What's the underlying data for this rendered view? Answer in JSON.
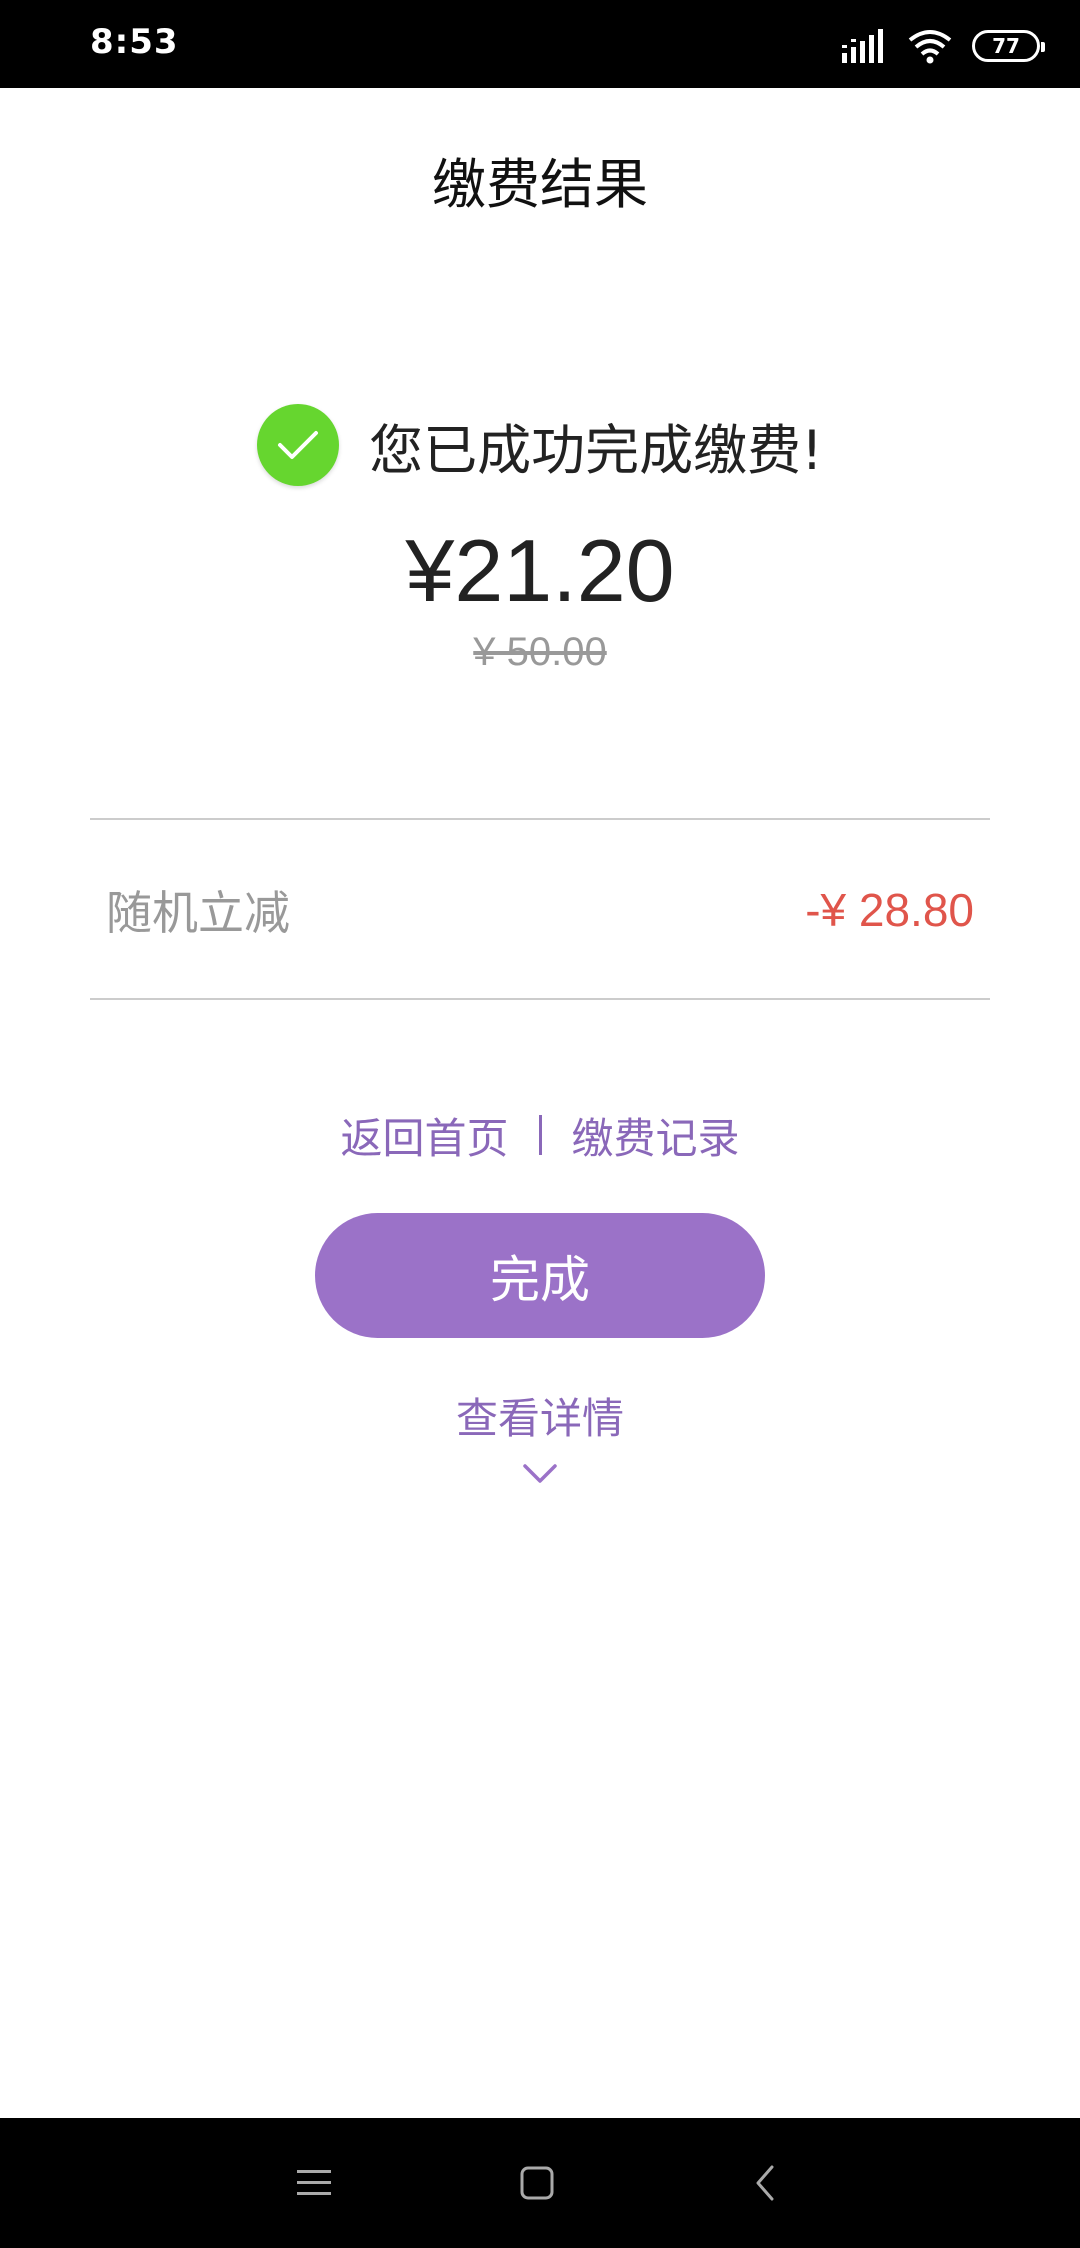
{
  "status_bar": {
    "time": "8:53",
    "battery": "77",
    "icons": [
      "signal-icon",
      "wifi-icon",
      "battery-icon"
    ]
  },
  "header": {
    "title": "缴费结果"
  },
  "result": {
    "icon": "check-circle-icon",
    "message": "您已成功完成缴费!",
    "amount": "¥21.20",
    "original_amount": "¥ 50.00"
  },
  "discount": {
    "label": "随机立减",
    "value": "-¥ 28.80"
  },
  "links": {
    "home": "返回首页",
    "records": "缴费记录"
  },
  "actions": {
    "done_label": "完成",
    "details_label": "查看详情"
  },
  "nav_bar": {
    "icons": [
      "menu-icon",
      "home-icon",
      "back-icon"
    ]
  },
  "colors": {
    "accent": "#9b72c8",
    "link": "#8a68b9",
    "success": "#66d62f",
    "discount": "#e0554b"
  }
}
